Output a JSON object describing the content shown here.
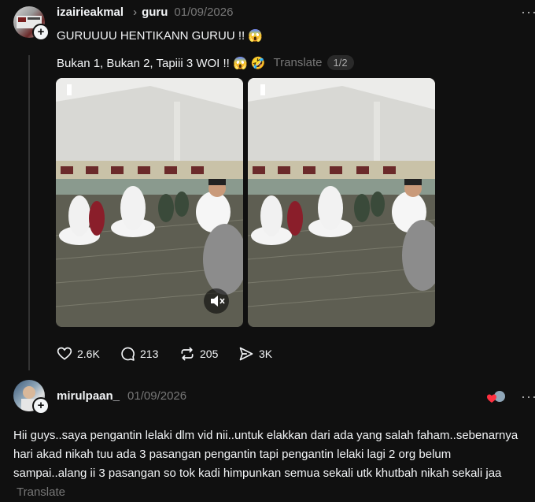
{
  "post": {
    "username": "izairieakmal",
    "topic_chevron": "›",
    "topic": "guru",
    "date": "01/09/2026",
    "title_text": "GURUUUU HENTIKANN GURUU !! 😱",
    "body_text": "Bukan 1, Bukan 2, Tapiii 3 WOI !! 😱 🤣",
    "translate_label": "Translate",
    "media_page": "1/2",
    "more": "···"
  },
  "actions": {
    "likes": "2.6K",
    "comments": "213",
    "reposts": "205",
    "shares": "3K"
  },
  "reply": {
    "username": "mirulpaan_",
    "date": "01/09/2026",
    "more": "···",
    "text": "Hii guys..saya pengantin lelaki dlm vid nii..untuk elakkan dari ada yang salah faham..sebenarnya hari akad nikah tuu ada 3 pasangan pengantin tapi pengantin lelaki lagi 2 org belum sampai..alang ii 3 pasangan so tok kadi himpunkan semua sekali utk khutbah nikah sekali jaa",
    "translate_label": "Translate"
  },
  "colors": {
    "background": "#101010",
    "text": "#f3f5f7",
    "muted": "#777777",
    "like_heart": "#ff3040"
  },
  "icons": [
    "plus-icon",
    "more-icon",
    "mute-icon",
    "heart-icon",
    "comment-icon",
    "repost-icon",
    "share-icon"
  ]
}
